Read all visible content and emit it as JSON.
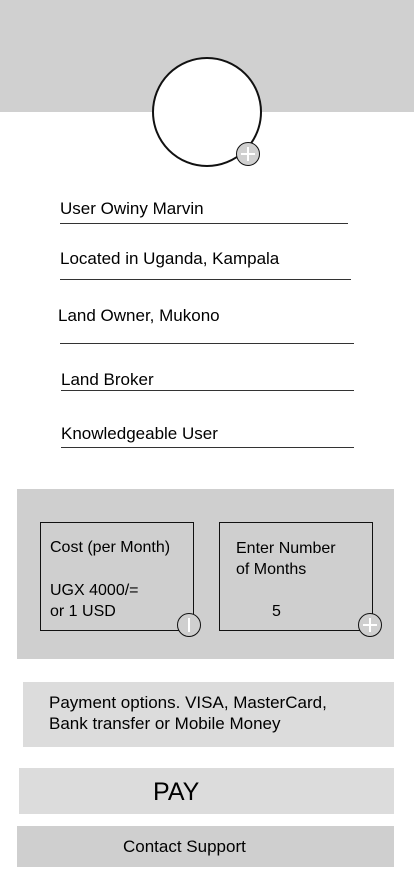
{
  "profile": {
    "user_name": "User Owiny  Marvin",
    "location": "Located in Uganda, Kampala",
    "land_owner": "Land Owner, Mukono",
    "role": "Land Broker",
    "experience": "Knowledgeable User",
    "avatar_icon": "user-icon",
    "add_photo_icon": "plus-icon"
  },
  "cost": {
    "label": "Cost (per Month)",
    "price_line1": "UGX 4000/=",
    "price_line2": "or 1 USD",
    "action_icon": "minus-icon"
  },
  "months": {
    "label_line1": "Enter Number",
    "label_line2": "of Months",
    "value": "5",
    "action_icon": "plus-icon"
  },
  "payment": {
    "line1": "Payment options. VISA, MasterCard,",
    "line2": "Bank transfer or Mobile Money"
  },
  "actions": {
    "pay_label": "PAY",
    "support_label": "Contact Support"
  },
  "colors": {
    "header_band": "#d0d0d0",
    "panel": "#cfcfcf",
    "button": "#dcdcdc"
  }
}
